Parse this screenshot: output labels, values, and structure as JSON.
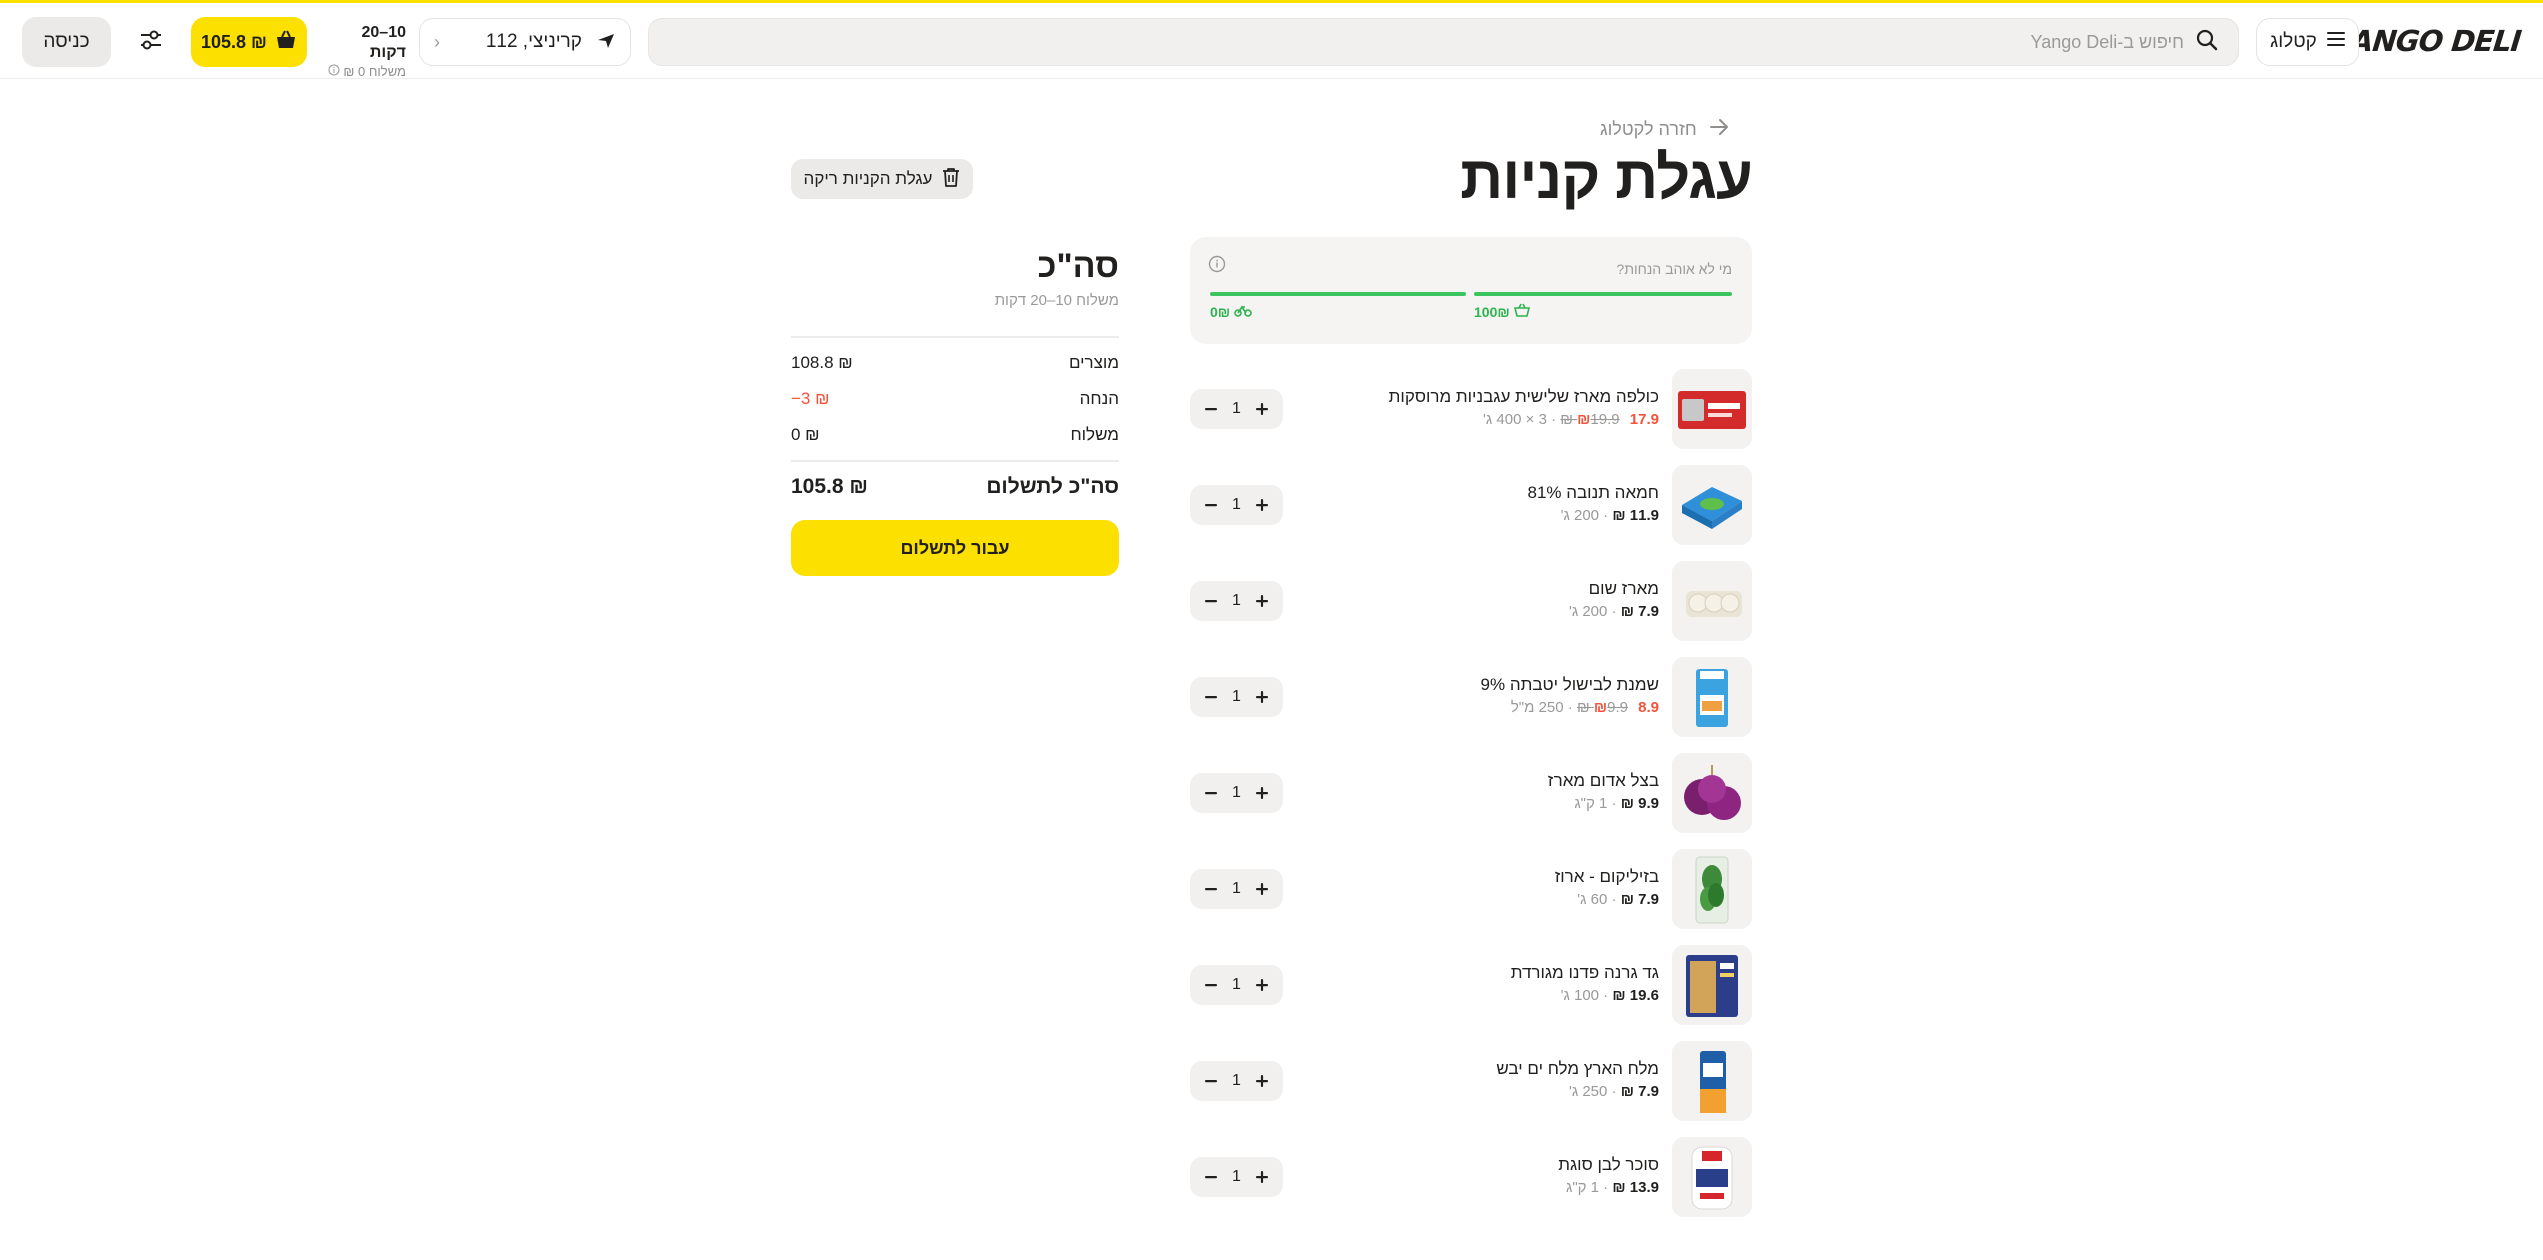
{
  "header": {
    "logo_text": "YANGO DELI",
    "catalog_label": "קטלוג",
    "search_placeholder": "חיפוש ב-Yango Deli",
    "address": "קריניצי, 112",
    "delivery_time": "10–20 דקות",
    "delivery_cost": "משלוח 0 ₪",
    "cart_total": "105.8 ₪",
    "login_label": "כניסה"
  },
  "page": {
    "back_label": "חזרה לקטלוג",
    "title": "עגלת קניות",
    "empty_cart_label": "עגלת הקניות ריקה"
  },
  "promo": {
    "text": "מי לא אוהב הנחות?",
    "progress": [
      {
        "label": "0₪",
        "icon": "bike-icon",
        "fill": 1.0
      },
      {
        "label": "100₪",
        "icon": "basket-icon",
        "fill": 1.0
      }
    ]
  },
  "items": [
    {
      "name": "כולפה מארז שלישית עגבניות מרוסקות",
      "price": "17.9 ₪",
      "old_price": "19.9 ₪",
      "weight": "3 × 400 ג'",
      "on_sale": true,
      "qty": "1",
      "image": "red-can-pack"
    },
    {
      "name": "חמאה תנובה 81%",
      "price": "11.9 ₪",
      "old_price": "",
      "weight": "200 ג'",
      "on_sale": false,
      "qty": "1",
      "image": "butter"
    },
    {
      "name": "מארז שום",
      "price": "7.9 ₪",
      "old_price": "",
      "weight": "200 ג'",
      "on_sale": false,
      "qty": "1",
      "image": "garlic"
    },
    {
      "name": "שמנת לבישול יטבתה 9%",
      "price": "8.9 ₪",
      "old_price": "9.9 ₪",
      "weight": "250 מ\"ל",
      "on_sale": true,
      "qty": "1",
      "image": "cream-carton"
    },
    {
      "name": "בצל אדום מארז",
      "price": "9.9 ₪",
      "old_price": "",
      "weight": "1 ק\"ג",
      "on_sale": false,
      "qty": "1",
      "image": "red-onion"
    },
    {
      "name": "בזיליקום - ארוז",
      "price": "7.9 ₪",
      "old_price": "",
      "weight": "60 ג'",
      "on_sale": false,
      "qty": "1",
      "image": "basil"
    },
    {
      "name": "גד גרנה פדנו מגורדת",
      "price": "19.6 ₪",
      "old_price": "",
      "weight": "100 ג'",
      "on_sale": false,
      "qty": "1",
      "image": "grated-cheese"
    },
    {
      "name": "מלח הארץ מלח ים יבש",
      "price": "7.9 ₪",
      "old_price": "",
      "weight": "250 ג'",
      "on_sale": false,
      "qty": "1",
      "image": "salt"
    },
    {
      "name": "סוכר לבן סוגת",
      "price": "13.9 ₪",
      "old_price": "",
      "weight": "1 ק\"ג",
      "on_sale": false,
      "qty": "1",
      "image": "sugar"
    }
  ],
  "summary": {
    "title": "סה\"כ",
    "subtitle": "משלוח 10–20 דקות",
    "rows": [
      {
        "label": "מוצרים",
        "value": "108.8 ₪"
      },
      {
        "label": "הנחה",
        "value": "−3 ₪"
      },
      {
        "label": "משלוח",
        "value": "0 ₪"
      }
    ],
    "total_label": "סה\"כ לתשלום",
    "total_value": "105.8 ₪",
    "checkout_label": "עבור לתשלום"
  },
  "colors": {
    "accent": "#fce000",
    "sale": "#f5523a",
    "progress": "#3ac55f",
    "muted": "#9a9998"
  }
}
